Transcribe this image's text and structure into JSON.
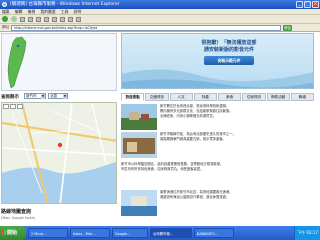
{
  "window": {
    "title": "[驗證碼] 台灣縣市服務 - Windows Internet Explorer"
  },
  "menu": [
    "檔案",
    "編輯",
    "檢視",
    "我的最愛",
    "工具",
    "說明"
  ],
  "address": {
    "label": "網址",
    "url": "http://inforce.moi.gov.tw/index.asp?tmp=lsCityId",
    "go_label": "移至"
  },
  "sidebar": {
    "region_label": "查詢縣市",
    "county_value": "新竹市",
    "district_value": "北區",
    "map_section_title": "路線地圖查詢",
    "map_section_sub": "(Map: Google Earth)"
  },
  "banner": {
    "line1": "很抱歉！「無法播放這部",
    "line2": "請安裝新版的影音元件",
    "button": "安裝示範元件"
  },
  "tabs": [
    "旅遊景點",
    "交通資訊",
    "人文",
    "特產",
    "美食",
    "住宿資訊",
    "節慶活動",
    "聯絡"
  ],
  "article": {
    "p1": [
      "新竹縣位於台灣西北部，是臺灣科學技術重鎮。",
      "縣內擁有多元族群文化，包括客家與原住民聚落。",
      "北埔老街、內灣小鎮等觀光資源豐富。"
    ],
    "p2": [
      "新竹市舊稱竹塹，為台灣北部歷史悠久的城市之一。",
      "城隍廟與東門城為重要古蹟，吸引眾多遊客。"
    ],
    "p3": [
      "新竹市以科學園區聞名，高科技產業蓬勃發展，並帶動地方經濟繁榮。",
      "市區內有許多特色美食，如米粉與貢丸，深受遊客喜愛。"
    ],
    "p4": [
      "南寮漁港位於新竹市北區，為當地重要觀光漁港。",
      "港邊設有海濱公園與自行車道，適合休閒旅遊。"
    ]
  },
  "taskbar": {
    "start": "開始",
    "tasks": [
      "2 Micro...",
      "Inbox - Micr...",
      "Google...",
      "台灣縣市服...",
      "BANKINFO..."
    ],
    "clock": "下午 03:17"
  }
}
